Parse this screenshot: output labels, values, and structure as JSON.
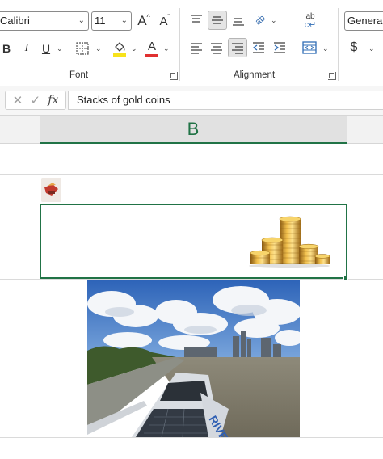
{
  "ribbon": {
    "font": {
      "font_name": "Calibri",
      "font_size": "11",
      "group_label": "Font",
      "grow_label": "A",
      "shrink_label": "A",
      "bold_label": "B",
      "italic_label": "I",
      "underline_label": "U",
      "font_color_label": "A",
      "font_color": "#e03030",
      "fill_color": "#f7e21b"
    },
    "alignment": {
      "group_label": "Alignment",
      "orientation_label": "ab",
      "wrap_label": "ab"
    },
    "number": {
      "format_value": "General",
      "currency_label": "$"
    }
  },
  "formula_bar": {
    "content": "Stacks of gold coins",
    "fx_label": "fx"
  },
  "sheet": {
    "column_label": "B",
    "accent_color": "#217346"
  },
  "images": [
    {
      "name": "Stacks of gold coins"
    },
    {
      "name": "thumbnail-icon"
    },
    {
      "name": "river-boat-photo"
    }
  ]
}
